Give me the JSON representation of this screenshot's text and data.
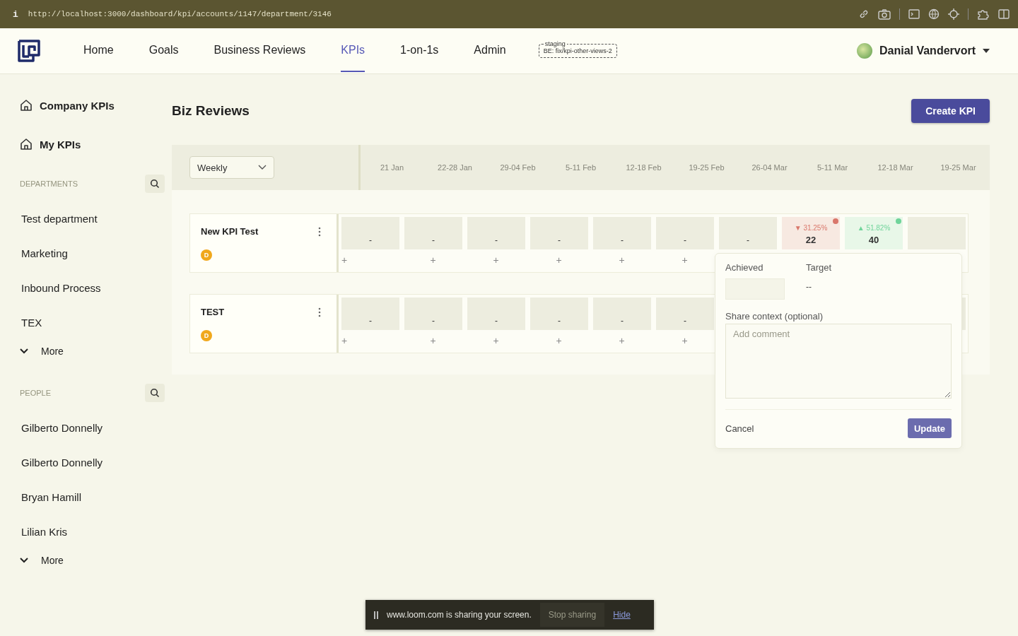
{
  "browser": {
    "info": "i",
    "url": "http://localhost:3000/dashboard/kpi/accounts/1147/department/3146"
  },
  "nav": {
    "items": [
      {
        "label": "Home",
        "selected": false
      },
      {
        "label": "Goals",
        "selected": false
      },
      {
        "label": "Business Reviews",
        "selected": false
      },
      {
        "label": "KPIs",
        "selected": true
      },
      {
        "label": "1-on-1s",
        "selected": false
      },
      {
        "label": "Admin",
        "selected": false
      }
    ],
    "env_badge": {
      "label": "staging",
      "branch": "BE: fix/kpi-other-views-2"
    },
    "user": {
      "name": "Danial Vandervort"
    }
  },
  "sidebar": {
    "links": [
      "Company KPIs",
      "My KPIs"
    ],
    "sections": [
      {
        "title": "DEPARTMENTS",
        "items": [
          "Test department",
          "Marketing",
          "Inbound Process",
          "TEX"
        ],
        "more": "More"
      },
      {
        "title": "PEOPLE",
        "items": [
          "Gilberto Donnelly",
          "Gilberto Donnelly",
          "Bryan Hamill",
          "Lilian Kris"
        ],
        "more": "More"
      }
    ]
  },
  "page": {
    "title": "Biz Reviews",
    "create_button": "Create KPI"
  },
  "grid": {
    "period_select": "Weekly",
    "periods": [
      "21 Jan",
      "22-28 Jan",
      "29-04 Feb",
      "5-11 Feb",
      "12-18 Feb",
      "19-25 Feb",
      "26-04 Mar",
      "5-11 Mar",
      "12-18 Mar",
      "19-25 Mar"
    ],
    "kpis": [
      {
        "name": "New KPI Test",
        "owner": "D",
        "cells": [
          {
            "value": "-",
            "add": "+"
          },
          {
            "value": "-",
            "add": "+"
          },
          {
            "value": "-",
            "add": "+"
          },
          {
            "value": "-",
            "add": "+"
          },
          {
            "value": "-",
            "add": "+"
          },
          {
            "value": "-",
            "add": "+"
          },
          {
            "value": "-"
          },
          {
            "value": "22",
            "change": "▼ 31.25%",
            "color": "#d9776b"
          },
          {
            "value": "40",
            "change": "▲ 51.82%",
            "color": "#6fd49a"
          }
        ]
      },
      {
        "name": "TEST",
        "owner": "D",
        "cells": [
          {
            "value": "-",
            "add": "+"
          },
          {
            "value": "-",
            "add": "+"
          },
          {
            "value": "-",
            "add": "+"
          },
          {
            "value": "-",
            "add": "+"
          },
          {
            "value": "-",
            "add": "+"
          },
          {
            "value": "-",
            "add": "+"
          }
        ]
      }
    ]
  },
  "popover": {
    "achieved_label": "Achieved",
    "target_label": "Target",
    "target_value": "--",
    "context_label": "Share context (optional)",
    "comment_placeholder": "Add comment",
    "cancel": "Cancel",
    "update": "Update"
  },
  "share_bar": {
    "message": "www.loom.com is sharing your screen.",
    "stop": "Stop sharing",
    "hide": "Hide"
  }
}
